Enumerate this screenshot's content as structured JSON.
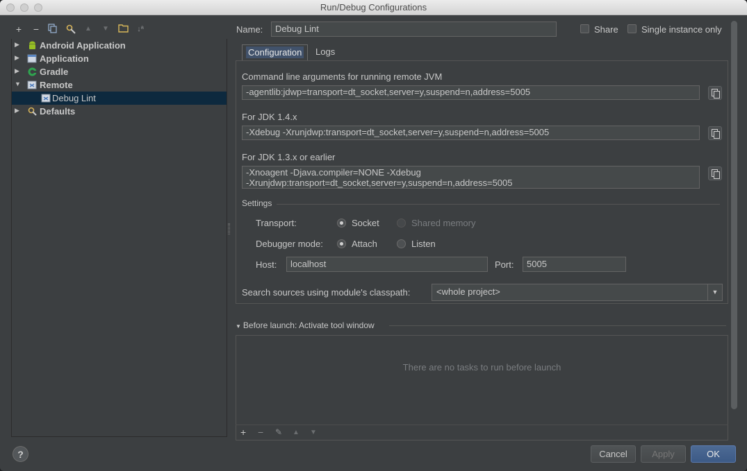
{
  "window": {
    "title": "Run/Debug Configurations"
  },
  "left_toolbar": {
    "icons": [
      "add-icon",
      "remove-icon",
      "copy-icon",
      "edit-defaults-icon",
      "move-up-icon",
      "move-down-icon",
      "folder-icon",
      "sort-icon"
    ]
  },
  "tree": {
    "items": [
      {
        "label": "Android Application",
        "icon": "android-icon",
        "expanded": false
      },
      {
        "label": "Application",
        "icon": "application-icon",
        "expanded": false
      },
      {
        "label": "Gradle",
        "icon": "gradle-icon",
        "expanded": false
      },
      {
        "label": "Remote",
        "icon": "remote-icon",
        "expanded": true
      },
      {
        "label": "Debug Lint",
        "icon": "remote-config-icon",
        "selected": true
      },
      {
        "label": "Defaults",
        "icon": "defaults-icon",
        "expanded": false
      }
    ]
  },
  "header": {
    "name_label": "Name:",
    "name_value": "Debug Lint",
    "share_label": "Share",
    "single_instance_label": "Single instance only"
  },
  "tabs": [
    {
      "label": "Configuration",
      "active": true
    },
    {
      "label": "Logs",
      "active": false
    }
  ],
  "config": {
    "cmd_label": "Command line arguments for running remote JVM",
    "cmd_value": "-agentlib:jdwp=transport=dt_socket,server=y,suspend=n,address=5005",
    "jdk14_label": "For JDK 1.4.x",
    "jdk14_value": "-Xdebug -Xrunjdwp:transport=dt_socket,server=y,suspend=n,address=5005",
    "jdk13_label": "For JDK 1.3.x or earlier",
    "jdk13_value_line1": "-Xnoagent -Djava.compiler=NONE -Xdebug",
    "jdk13_value_line2": "-Xrunjdwp:transport=dt_socket,server=y,suspend=n,address=5005",
    "settings_label": "Settings",
    "transport_label": "Transport:",
    "transport_socket": "Socket",
    "transport_shared": "Shared memory",
    "debugger_mode_label": "Debugger mode:",
    "mode_attach": "Attach",
    "mode_listen": "Listen",
    "host_label": "Host:",
    "host_value": "localhost",
    "port_label": "Port:",
    "port_value": "5005",
    "classpath_label": "Search sources using module's classpath:",
    "classpath_value": "<whole project>"
  },
  "before_launch": {
    "title": "Before launch: Activate tool window",
    "empty_text": "There are no tasks to run before launch"
  },
  "footer": {
    "help": "?",
    "cancel": "Cancel",
    "apply": "Apply",
    "ok": "OK"
  }
}
